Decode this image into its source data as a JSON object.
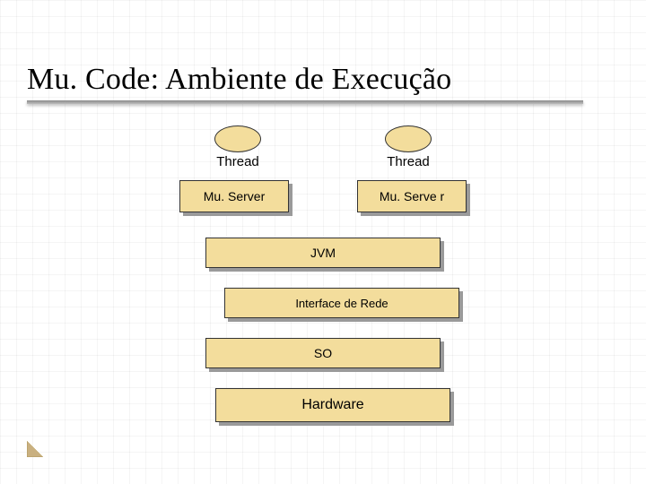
{
  "title": "Mu. Code: Ambiente de Execução",
  "threads": {
    "left_label": "Thread",
    "right_label": "Thread"
  },
  "muserver": {
    "left_label": "Mu. Server",
    "right_label": "Mu. Serve r"
  },
  "jvm_label": "JVM",
  "network_label": "Interface de Rede",
  "so_label": "SO",
  "hardware_label": "Hardware",
  "colors": {
    "box_fill": "#f3dd9c",
    "box_border": "#333333",
    "shadow": "#9a9a9a"
  }
}
